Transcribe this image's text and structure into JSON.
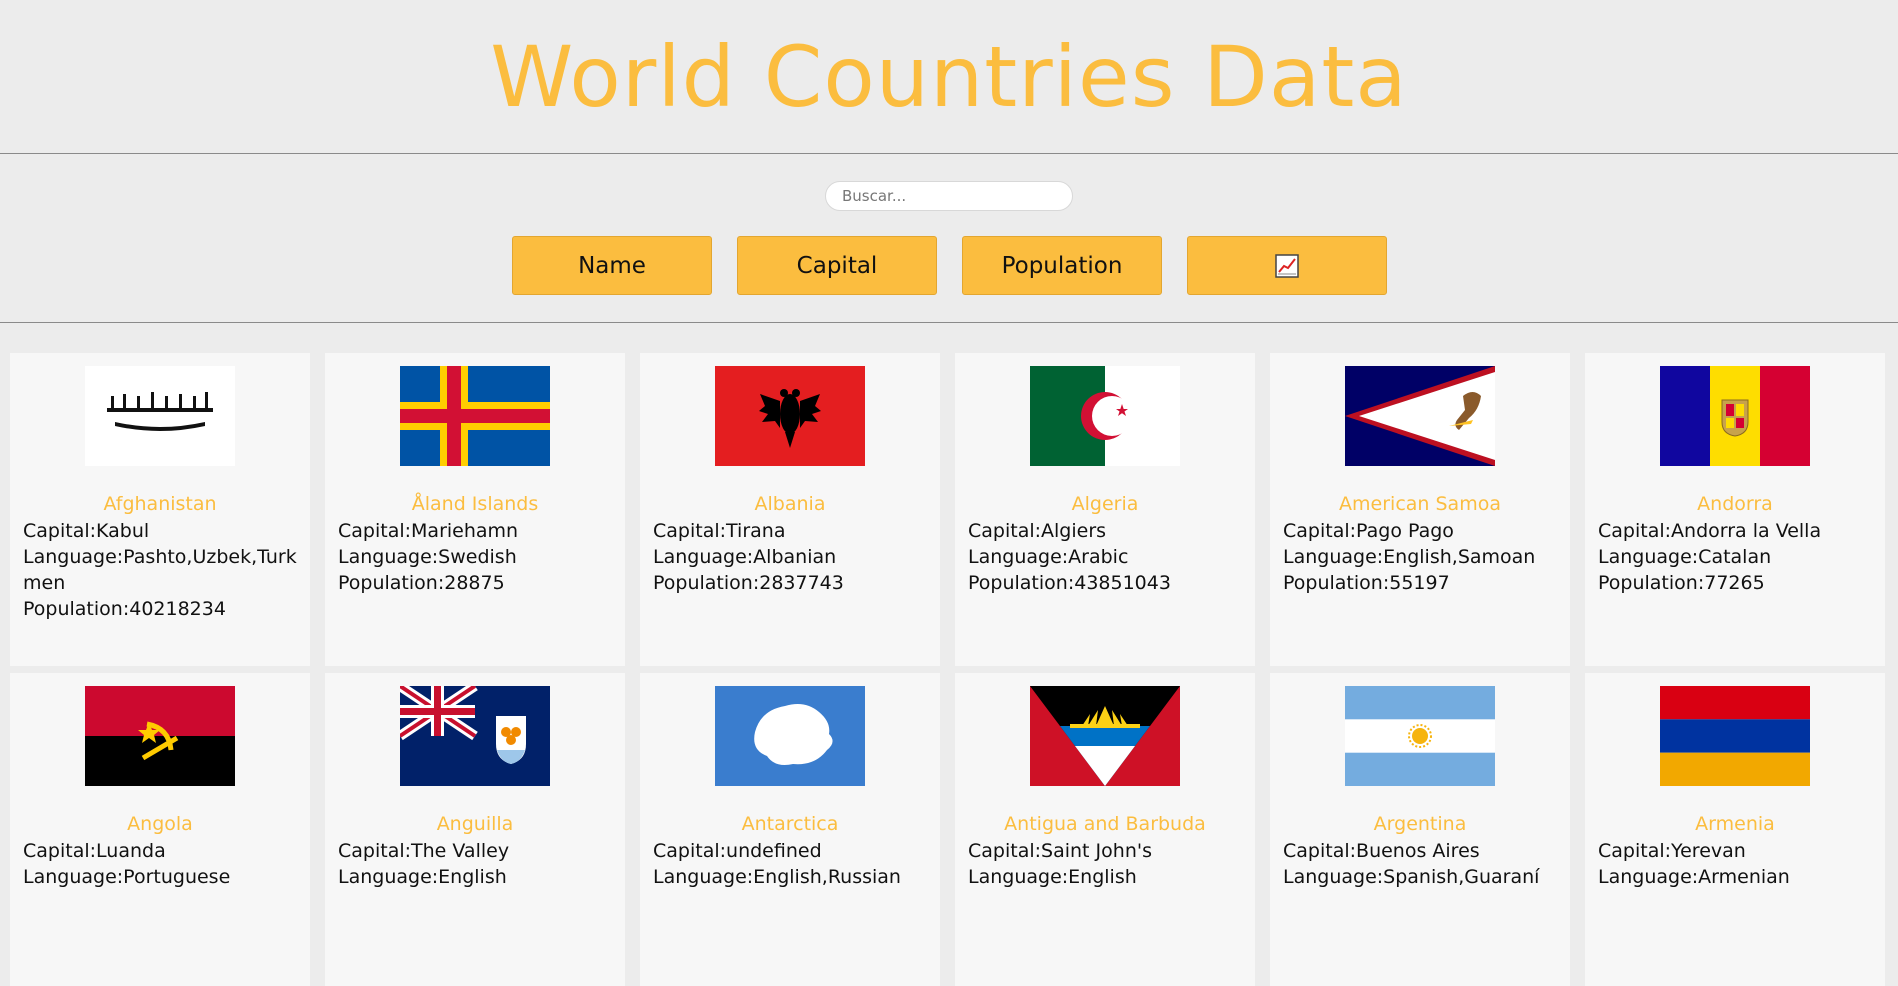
{
  "header": {
    "title": "World Countries Data"
  },
  "search": {
    "placeholder": "Buscar..."
  },
  "sort_buttons": {
    "name": "Name",
    "capital": "Capital",
    "population": "Population",
    "chart_icon": "chart-trend-icon"
  },
  "labels": {
    "capital": "Capital:",
    "language": "Language:",
    "population": "Population:"
  },
  "colors": {
    "accent": "#fbbd3f",
    "background": "#ececec",
    "card": "#f7f7f7"
  },
  "countries": [
    {
      "name": "Afghanistan",
      "capital": "Kabul",
      "language": "Pashto,Uzbek,Turkmen",
      "population": "40218234",
      "flag": "afghanistan-flag"
    },
    {
      "name": "Åland Islands",
      "capital": "Mariehamn",
      "language": "Swedish",
      "population": "28875",
      "flag": "aland-islands-flag"
    },
    {
      "name": "Albania",
      "capital": "Tirana",
      "language": "Albanian",
      "population": "2837743",
      "flag": "albania-flag"
    },
    {
      "name": "Algeria",
      "capital": "Algiers",
      "language": "Arabic",
      "population": "43851043",
      "flag": "algeria-flag"
    },
    {
      "name": "American Samoa",
      "capital": "Pago Pago",
      "language": "English,Samoan",
      "population": "55197",
      "flag": "american-samoa-flag"
    },
    {
      "name": "Andorra",
      "capital": "Andorra la Vella",
      "language": "Catalan",
      "population": "77265",
      "flag": "andorra-flag"
    },
    {
      "name": "Angola",
      "capital": "Luanda",
      "language": "Portuguese",
      "population": "",
      "flag": "angola-flag"
    },
    {
      "name": "Anguilla",
      "capital": "The Valley",
      "language": "English",
      "population": "",
      "flag": "anguilla-flag"
    },
    {
      "name": "Antarctica",
      "capital": "undefined",
      "language": "English,Russian",
      "population": "",
      "flag": "antarctica-flag"
    },
    {
      "name": "Antigua and Barbuda",
      "capital": "Saint John's",
      "language": "English",
      "population": "",
      "flag": "antigua-and-barbuda-flag"
    },
    {
      "name": "Argentina",
      "capital": "Buenos Aires",
      "language": "Spanish,Guaraní",
      "population": "",
      "flag": "argentina-flag"
    },
    {
      "name": "Armenia",
      "capital": "Yerevan",
      "language": "Armenian",
      "population": "",
      "flag": "armenia-flag"
    }
  ]
}
